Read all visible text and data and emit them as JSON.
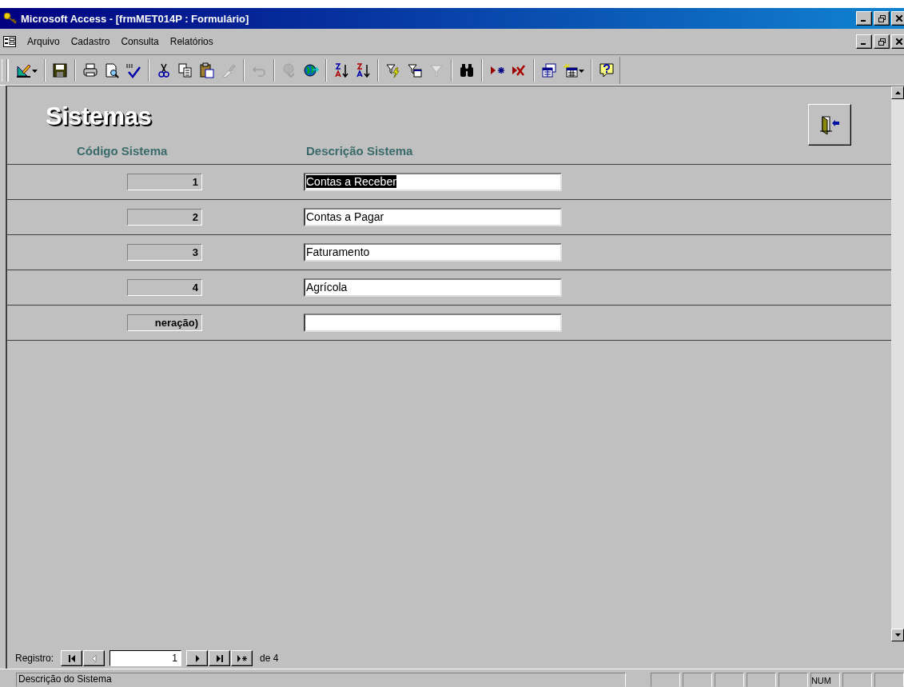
{
  "window": {
    "title": "Microsoft Access - [frmMET014P : Formulário]"
  },
  "menu": [
    {
      "label": "Arquivo"
    },
    {
      "label": "Cadastro"
    },
    {
      "label": "Consulta"
    },
    {
      "label": "Relatórios"
    }
  ],
  "toolbar": [
    {
      "kind": "design",
      "disabled": false
    },
    {
      "kind": "separator"
    },
    {
      "kind": "save",
      "disabled": false
    },
    {
      "kind": "separator"
    },
    {
      "kind": "print",
      "disabled": false
    },
    {
      "kind": "preview",
      "disabled": false
    },
    {
      "kind": "spell",
      "disabled": false
    },
    {
      "kind": "separator"
    },
    {
      "kind": "cut",
      "disabled": false
    },
    {
      "kind": "copy",
      "disabled": false
    },
    {
      "kind": "paste",
      "disabled": false
    },
    {
      "kind": "brush",
      "disabled": true
    },
    {
      "kind": "separator"
    },
    {
      "kind": "undo",
      "disabled": true
    },
    {
      "kind": "separator"
    },
    {
      "kind": "link",
      "disabled": true
    },
    {
      "kind": "globe",
      "disabled": false
    },
    {
      "kind": "separator"
    },
    {
      "kind": "sort-asc",
      "disabled": false
    },
    {
      "kind": "sort-desc",
      "disabled": false
    },
    {
      "kind": "separator"
    },
    {
      "kind": "filter-selection",
      "disabled": false
    },
    {
      "kind": "filter-form",
      "disabled": false
    },
    {
      "kind": "filter",
      "disabled": true
    },
    {
      "kind": "separator"
    },
    {
      "kind": "find",
      "disabled": false
    },
    {
      "kind": "separator"
    },
    {
      "kind": "new-record",
      "disabled": false
    },
    {
      "kind": "delete-record",
      "disabled": false
    },
    {
      "kind": "separator"
    },
    {
      "kind": "database",
      "disabled": false
    },
    {
      "kind": "new-object",
      "disabled": false
    },
    {
      "kind": "separator"
    },
    {
      "kind": "help",
      "disabled": false
    }
  ],
  "form": {
    "title": "Sistemas",
    "columns": [
      "Código Sistema",
      "Descrição Sistema"
    ],
    "rows": [
      {
        "kind": "record",
        "code": "1",
        "description": "Contas a Receber",
        "selected": true
      },
      {
        "kind": "record",
        "code": "2",
        "description": "Contas a Pagar",
        "selected": false
      },
      {
        "kind": "record",
        "code": "3",
        "description": "Faturamento",
        "selected": false
      },
      {
        "kind": "record",
        "code": "4",
        "description": "Agrícola",
        "selected": false
      },
      {
        "kind": "new",
        "code": "neração)",
        "selected": false
      }
    ]
  },
  "navigator": {
    "label": "Registro:",
    "current": "1",
    "total": "de 4"
  },
  "status_bar": {
    "text": "Descrição do Sistema",
    "indicators": [
      "NUM"
    ]
  }
}
